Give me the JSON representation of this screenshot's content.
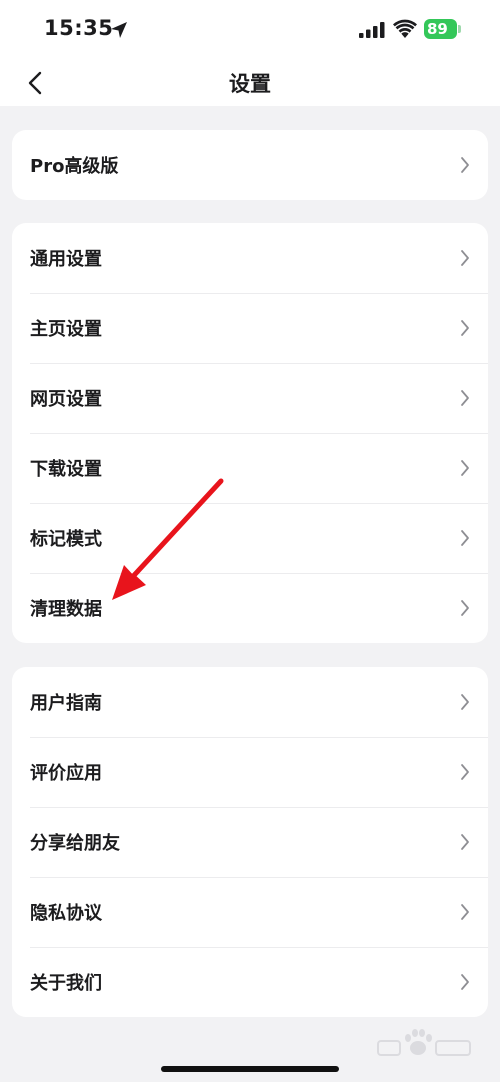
{
  "status_bar": {
    "time": "15:35",
    "battery": "89",
    "icons": [
      "location-arrow-icon",
      "cellular-signal-icon",
      "wifi-icon",
      "battery-icon"
    ]
  },
  "nav": {
    "title": "设置",
    "back_icon": "chevron-left-icon"
  },
  "groups": [
    {
      "items": [
        {
          "label": "Pro高级版"
        }
      ]
    },
    {
      "items": [
        {
          "label": "通用设置"
        },
        {
          "label": "主页设置"
        },
        {
          "label": "网页设置"
        },
        {
          "label": "下载设置"
        },
        {
          "label": "标记模式"
        },
        {
          "label": "清理数据"
        }
      ]
    },
    {
      "items": [
        {
          "label": "用户指南"
        },
        {
          "label": "评价应用"
        },
        {
          "label": "分享给朋友"
        },
        {
          "label": "隐私协议"
        },
        {
          "label": "关于我们"
        }
      ]
    }
  ],
  "row_icon": "chevron-right-icon",
  "colors": {
    "background": "#f2f2f4",
    "card": "#ffffff",
    "battery": "#34c759",
    "annotation_arrow": "#e8141c"
  }
}
